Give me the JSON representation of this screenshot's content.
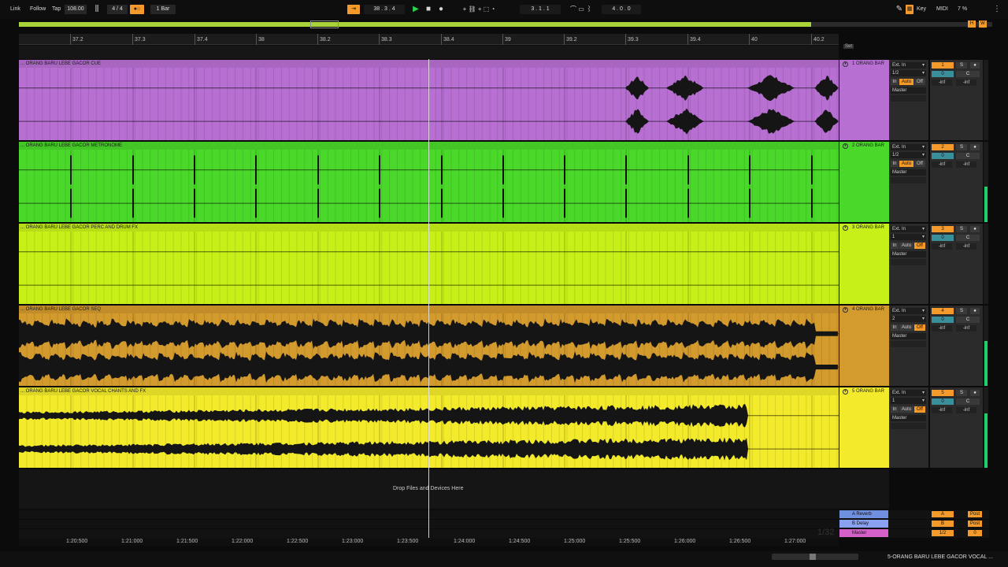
{
  "topbar": {
    "link": "Link",
    "follow": "Follow",
    "tap": "Tap",
    "tempo": "108.00",
    "signature": "4 / 4",
    "quantize": "1 Bar",
    "position": "38 .   3 .   4",
    "loop_start": "3 .   1 .   1",
    "loop_length": "4 .   0 .   0",
    "key": "Key",
    "midi": "MIDI",
    "cpu": "7 %"
  },
  "ruler": {
    "bars": [
      "37.2",
      "37.3",
      "37.4",
      "38",
      "38.2",
      "38.3",
      "38.4",
      "39",
      "39.2",
      "39.3",
      "39.4",
      "40",
      "40.2"
    ]
  },
  "set_tag": "Set",
  "tracks": [
    {
      "clip": "... ORANG BARU LEBE GACOR CUE",
      "name": "1 ORANG BAR",
      "color": "#b76fd2",
      "input": "Ext. In",
      "channel": "1/2",
      "monitor": "Auto",
      "number": "1",
      "volume": "0",
      "pan": "C",
      "db_left": "-inf",
      "db_right": "-inf",
      "output": "Master",
      "meter": 0
    },
    {
      "clip": "... ORANG BARU LEBE GACOR METRONOME",
      "name": "2 ORANG BAR",
      "color": "#4ad82a",
      "input": "Ext. In",
      "channel": "1/2",
      "monitor": "Auto",
      "number": "2",
      "volume": "0",
      "pan": "C",
      "db_left": "-inf",
      "db_right": "-inf",
      "output": "Master",
      "meter": 0.55
    },
    {
      "clip": "... ORANG BARU LEBE GACOR PERC AND DRUM FX",
      "name": "3 ORANG BAR",
      "color": "#c6f018",
      "input": "Ext. In",
      "channel": "1",
      "monitor": "Auto",
      "number": "3",
      "volume": "0",
      "pan": "C",
      "db_left": "-inf",
      "db_right": "-inf",
      "output": "Master",
      "meter": 0
    },
    {
      "clip": "... ORANG BARU LEBE GACOR SEQ",
      "name": "4 ORANG BAR",
      "color": "#d39a2d",
      "input": "Ext. In",
      "channel": "2",
      "monitor": "Auto",
      "number": "4",
      "volume": "0",
      "pan": "C",
      "db_left": "-inf",
      "db_right": "-inf",
      "output": "Master",
      "meter": 0.7
    },
    {
      "clip": "... ORANG BARU LEBE GACOR VOCAL CHANTS AND FX",
      "name": "5 ORANG BAR",
      "color": "#f2ea2a",
      "input": "Ext. In",
      "channel": "1",
      "monitor": "Auto",
      "number": "5",
      "volume": "0",
      "pan": "C",
      "db_left": "-inf",
      "db_right": "-inf",
      "output": "Master",
      "meter": 0.85
    }
  ],
  "monitor_labels": {
    "in": "In",
    "auto": "Auto",
    "off": "Off"
  },
  "drop_text": "Drop Files and Devices Here",
  "returns": [
    {
      "name": "A Reverb",
      "color": "#6f8fe0",
      "letter": "A",
      "post": "Post"
    },
    {
      "name": "B Delay",
      "color": "#8aa0f0",
      "letter": "B",
      "post": "Post"
    },
    {
      "name": "Master",
      "color": "#d560c8",
      "letter": "1/2",
      "post": "0"
    }
  ],
  "time_ruler": [
    "1:20:500",
    "1:21:000",
    "1:21:500",
    "1:22:000",
    "1:22:500",
    "1:23:000",
    "1:23:500",
    "1:24:000",
    "1:24:500",
    "1:25:000",
    "1:25:500",
    "1:26:000",
    "1:26:500",
    "1:27:000"
  ],
  "page_num": "1/32",
  "status": "5-ORANG BARU LEBE GACOR VOCAL ...",
  "colors": {
    "accent": "#f49a2a",
    "overview": "#a8d43a",
    "playhead": "#e6e6e6"
  }
}
